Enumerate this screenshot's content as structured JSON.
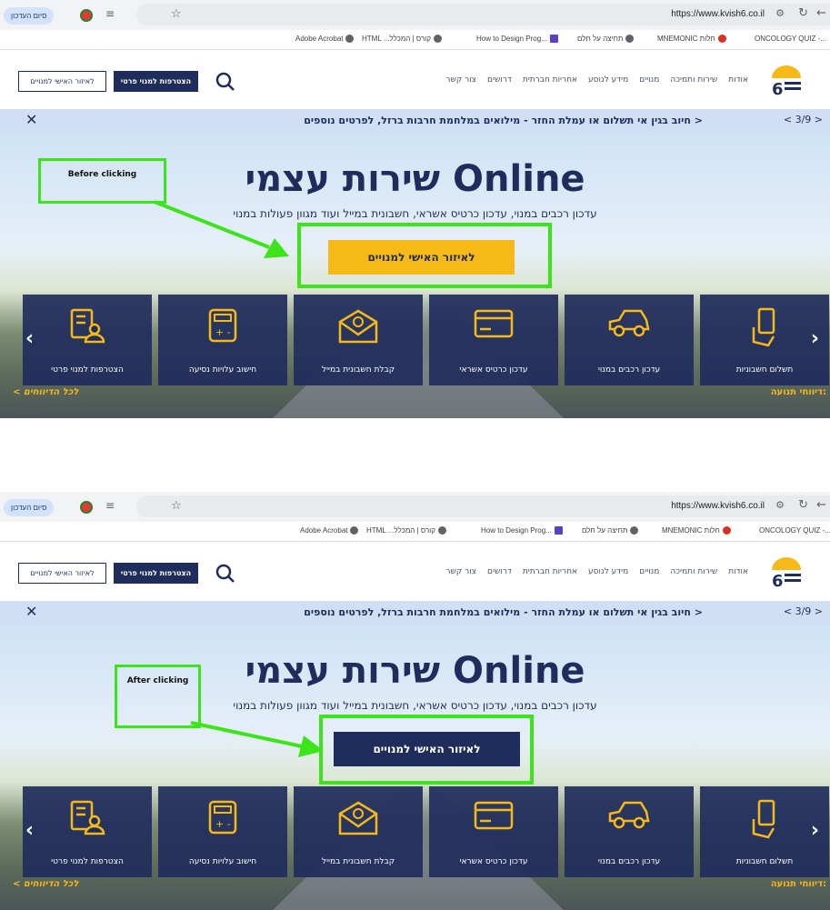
{
  "browser": {
    "url": "https://www.kvish6.co.il",
    "update_button": "סיום העדכון",
    "bookmarks": [
      "Adobe Acrobat",
      "HTML ...קורס | המכלל",
      "How to Design Prog...",
      "תחיצה על חלם",
      "MNEMONIC חלות",
      "ONCOLOGY QUIZ -..."
    ]
  },
  "site": {
    "nav": [
      "אודות",
      "שירות ותמיכה",
      "מנויים",
      "מידע לנוסע",
      "אחריות חברתית",
      "דרושים",
      "צור קשר"
    ],
    "join_button": "הצטרפות למנוי פרטי",
    "personal_area_button": "לאיזור האישי למנויים",
    "ticker_msg": "חיוב בגין אי תשלום או עמלת החזר - מילואים במלחמת חרבות ברזל,  לפרטים נוספים >",
    "ticker_count": "< 3/9 >",
    "hero_title": "שירות עצמי Online",
    "hero_subtitle": "עדכון רכבים במנוי, עדכון כרטיס אשראי, חשבונית במייל ועוד מגוון פעולות במנוי",
    "cta_label": "לאיזור האישי למנויים",
    "tiles": [
      {
        "label": "תשלום חשבוניות",
        "icon": "hand-phone-icon"
      },
      {
        "label": "עדכון רכבים במנוי",
        "icon": "car-icon"
      },
      {
        "label": "עדכון כרטיס אשראי",
        "icon": "credit-card-icon"
      },
      {
        "label": "קבלת חשבונית במייל",
        "icon": "email-icon"
      },
      {
        "label": "חישוב עלויות נסיעה",
        "icon": "calculator-icon"
      },
      {
        "label": "הצטרפות למנוי פרטי",
        "icon": "form-user-icon"
      }
    ],
    "all_reports": "< לכל הדיווחים",
    "traffic_reports": "דיווחי תנועה:"
  },
  "annotations": {
    "before": "Before clicking",
    "after": "After clicking"
  },
  "colors": {
    "navy": "#1f2d5c",
    "yellow": "#f7b917",
    "highlight": "#3ce41a"
  }
}
